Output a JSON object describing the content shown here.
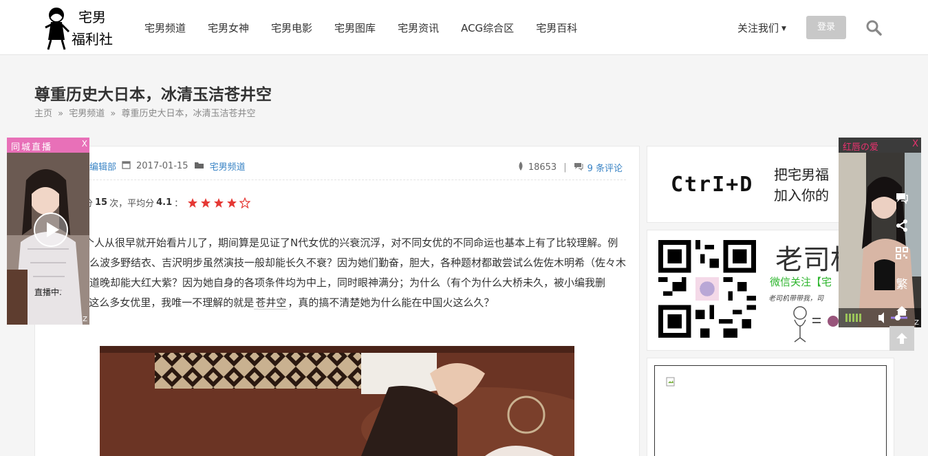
{
  "header": {
    "logo_text": "宅男福利社",
    "nav": [
      "宅男频道",
      "宅男女神",
      "宅男电影",
      "宅男图库",
      "宅男资讯",
      "ACG综合区",
      "宅男百科"
    ],
    "follow_label": "关注我们",
    "login_label": "登录"
  },
  "page": {
    "title": "尊重历史大日本，冰清玉洁苍井空",
    "breadcrumb": [
      "主页",
      "宅男频道",
      "尊重历史大日本，冰清玉洁苍井空"
    ],
    "breadcrumb_sep": "»"
  },
  "article": {
    "author": "编辑部",
    "date": "2017-01-15",
    "category": "宅男频道",
    "views": "18653",
    "comments": "9 条评论",
    "rating_prefix": "分",
    "rating_count": "15",
    "rating_mid": "次，平均分",
    "rating_avg": "4.1",
    "rating_suffix": "：",
    "stars_filled": 4,
    "stars_total": 5,
    "body_part1": "个人从很早就开始看片儿了，期间算是见证了N代女优的兴衰沉浮，对不同女优的不同命运也基本上有了比较理解。例如：为什么波多野结衣、吉沢明步虽然演技一般却能长久不衰？因为她们勤奋，胆大，各种题材都敢尝试么佐佐木明希（佐々木あき）出道晚却能大红大紫？因为她自身的各项条件均为中上，同时眼神满分；为什么（有个为什么大桥未久，被小编我删了）...在这么多女优里，我唯一不理解的就是",
    "body_keyword": "苍井空",
    "body_part2": "，真的搞不清楚她为什么能在中国火这么久？"
  },
  "sidebar": {
    "brand_logo": "CtrI+D",
    "slogan_line1": "把宅男福",
    "slogan_line2": "加入你的",
    "wechat_brand": "老司机",
    "wechat_text": "微信关注【宅",
    "wechat_small": "老司机带带我，司"
  },
  "live_left": {
    "title": "同城直播",
    "close": "X",
    "status": "直播中.",
    "corner": "Z"
  },
  "live_right": {
    "title": "红唇の爱",
    "close": "X",
    "corner": "Z"
  },
  "tools": {
    "traditional_label": "繁"
  },
  "colors": {
    "accent_blue": "#3a84c5",
    "star_red": "#e53935",
    "live_pink": "#e870b8"
  }
}
